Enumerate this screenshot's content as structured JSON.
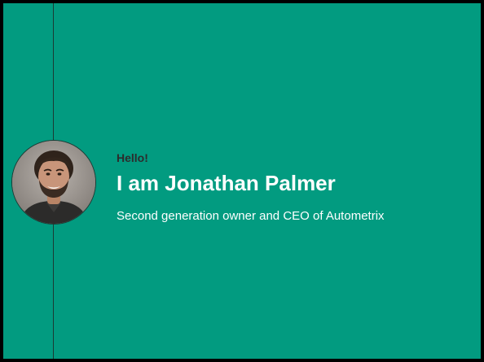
{
  "slide": {
    "greeting": "Hello!",
    "name_heading": "I am Jonathan Palmer",
    "subtitle": "Second generation owner and CEO of Autometrix",
    "background_color": "#029b80",
    "border_color": "#000000",
    "avatar_icon": "person-photo-icon"
  }
}
